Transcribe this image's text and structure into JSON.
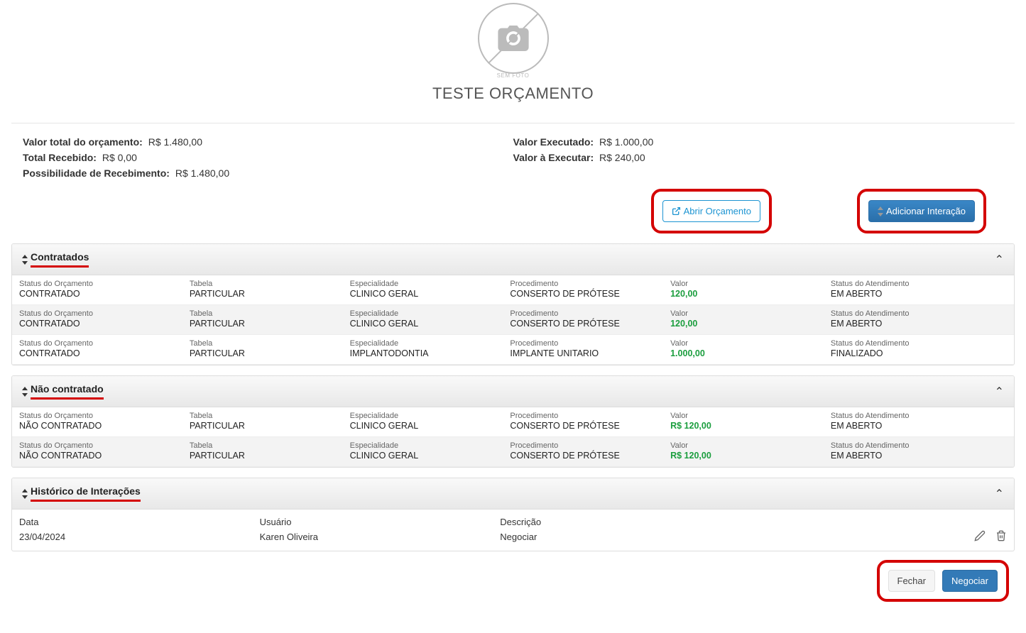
{
  "profile": {
    "avatar_caption": "SEM FOTO",
    "name": "TESTE ORÇAMENTO"
  },
  "summary": {
    "left": {
      "valor_total_label": "Valor total do orçamento:",
      "valor_total_value": "R$ 1.480,00",
      "total_recebido_label": "Total Recebido:",
      "total_recebido_value": "R$ 0,00",
      "possibilidade_label": "Possibilidade de Recebimento:",
      "possibilidade_value": "R$ 1.480,00"
    },
    "right": {
      "valor_executado_label": "Valor Executado:",
      "valor_executado_value": "R$ 1.000,00",
      "valor_a_executar_label": "Valor à Executar:",
      "valor_a_executar_value": "R$ 240,00"
    }
  },
  "buttons": {
    "abrir_orcamento": "Abrir Orçamento",
    "adicionar_interacao": "Adicionar Interação",
    "fechar": "Fechar",
    "negociar": "Negociar"
  },
  "labels": {
    "status_orcamento": "Status do Orçamento",
    "tabela": "Tabela",
    "especialidade": "Especialidade",
    "procedimento": "Procedimento",
    "valor": "Valor",
    "status_atendimento": "Status do Atendimento"
  },
  "panels": {
    "contratados": {
      "title": "Contratados",
      "rows": [
        {
          "status": "CONTRATADO",
          "tabela": "PARTICULAR",
          "esp": "CLINICO GERAL",
          "proc": "CONSERTO DE PRÓTESE",
          "valor": "120,00",
          "atend": "EM ABERTO"
        },
        {
          "status": "CONTRATADO",
          "tabela": "PARTICULAR",
          "esp": "CLINICO GERAL",
          "proc": "CONSERTO DE PRÓTESE",
          "valor": "120,00",
          "atend": "EM ABERTO"
        },
        {
          "status": "CONTRATADO",
          "tabela": "PARTICULAR",
          "esp": "IMPLANTODONTIA",
          "proc": "IMPLANTE UNITARIO",
          "valor": "1.000,00",
          "atend": "FINALIZADO"
        }
      ]
    },
    "nao_contratado": {
      "title": "Não contratado",
      "rows": [
        {
          "status": "NÃO CONTRATADO",
          "tabela": "PARTICULAR",
          "esp": "CLINICO GERAL",
          "proc": "CONSERTO DE PRÓTESE",
          "valor": "R$ 120,00",
          "atend": "EM ABERTO"
        },
        {
          "status": "NÃO CONTRATADO",
          "tabela": "PARTICULAR",
          "esp": "CLINICO GERAL",
          "proc": "CONSERTO DE PRÓTESE",
          "valor": "R$ 120,00",
          "atend": "EM ABERTO"
        }
      ]
    },
    "historico": {
      "title": "Histórico de Interações",
      "headers": {
        "data": "Data",
        "usuario": "Usuário",
        "descricao": "Descrição"
      },
      "rows": [
        {
          "data": "23/04/2024",
          "usuario": "Karen Oliveira",
          "descricao": "Negociar"
        }
      ]
    }
  }
}
